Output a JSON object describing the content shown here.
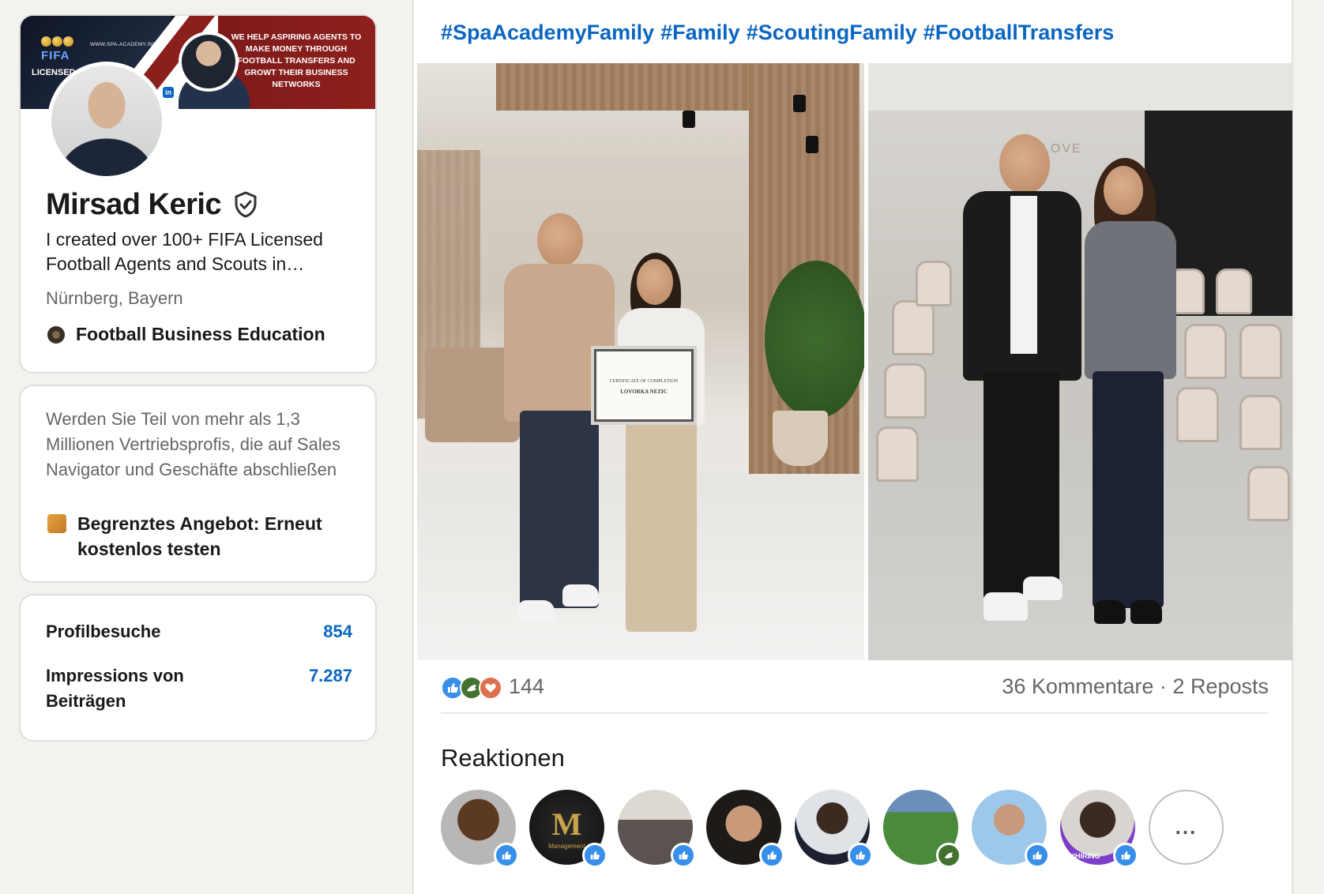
{
  "profile": {
    "banner": {
      "url": "WWW.SPA-ACADEMY.INFO",
      "fifa": "FIFA",
      "licensed": "LICENSED",
      "tagline": "WE HELP ASPIRING AGENTS TO MAKE MONEY THROUGH FOOTBALL TRANSFERS AND GROWT THEIR BUSINESS NETWORKS",
      "linkedin_glyph": "in"
    },
    "name": "Mirsad Keric",
    "verified_icon": "shield-check-icon",
    "headline": "I created over 100+ FIFA Licensed Football Agents and Scouts in…",
    "location": "Nürnberg, Bayern",
    "company": "Football Business Education"
  },
  "premium": {
    "text": "Werden Sie Teil von mehr als 1,3 Millionen Vertriebsprofis, die auf Sales Navigator und Geschäfte abschließen",
    "offer": "Begrenztes Angebot: Erneut kostenlos testen"
  },
  "stats": [
    {
      "label": "Profilbesuche",
      "value": "854"
    },
    {
      "label": "Impressions von Beiträgen",
      "value": "7.287"
    }
  ],
  "post": {
    "hashtags": [
      "#SpaAcademyFamily",
      "#Family",
      "#ScoutingFamily",
      "#FootballTransfers"
    ],
    "certificate": {
      "heading": "CERTIFICATE OF COMPLETION",
      "name": "LOVORKA NEZIC"
    },
    "wall_text": "LOVE",
    "reaction_count": "144",
    "engagement": "36 Kommentare · 2 Reposts",
    "reactions_title": "Reaktionen",
    "reactor_badges": [
      "like",
      "like",
      "like",
      "like",
      "like",
      "support",
      "like",
      "like"
    ],
    "avatar_texts": {
      "management": "Management",
      "hiring": "#HIRING"
    },
    "more_label": "..."
  },
  "colors": {
    "link_blue": "#0a66c2",
    "like_blue": "#378fe9",
    "support_green": "#44712e",
    "love_orange": "#df704d",
    "banner_red": "#8e201d"
  }
}
